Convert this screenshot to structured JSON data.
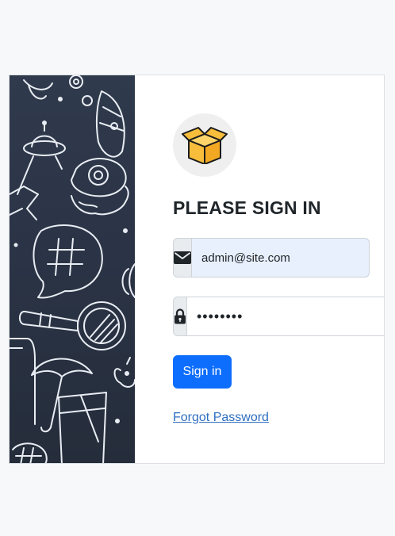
{
  "login": {
    "title": "PLEASE SIGN IN",
    "email": {
      "value": "admin@site.com",
      "placeholder": "",
      "icon": "envelope-icon"
    },
    "password": {
      "value": "••••••••",
      "icon": "lock-icon"
    },
    "submit_label": "Sign in",
    "forgot_label": "Forgot Password",
    "logo_icon": "open-box-icon"
  },
  "colors": {
    "primary": "#0d6efd",
    "link": "#2f6fc0",
    "art_bg": "#2b3446",
    "autofill_bg": "#e8f0fe",
    "addon_bg": "#e9ecef"
  }
}
